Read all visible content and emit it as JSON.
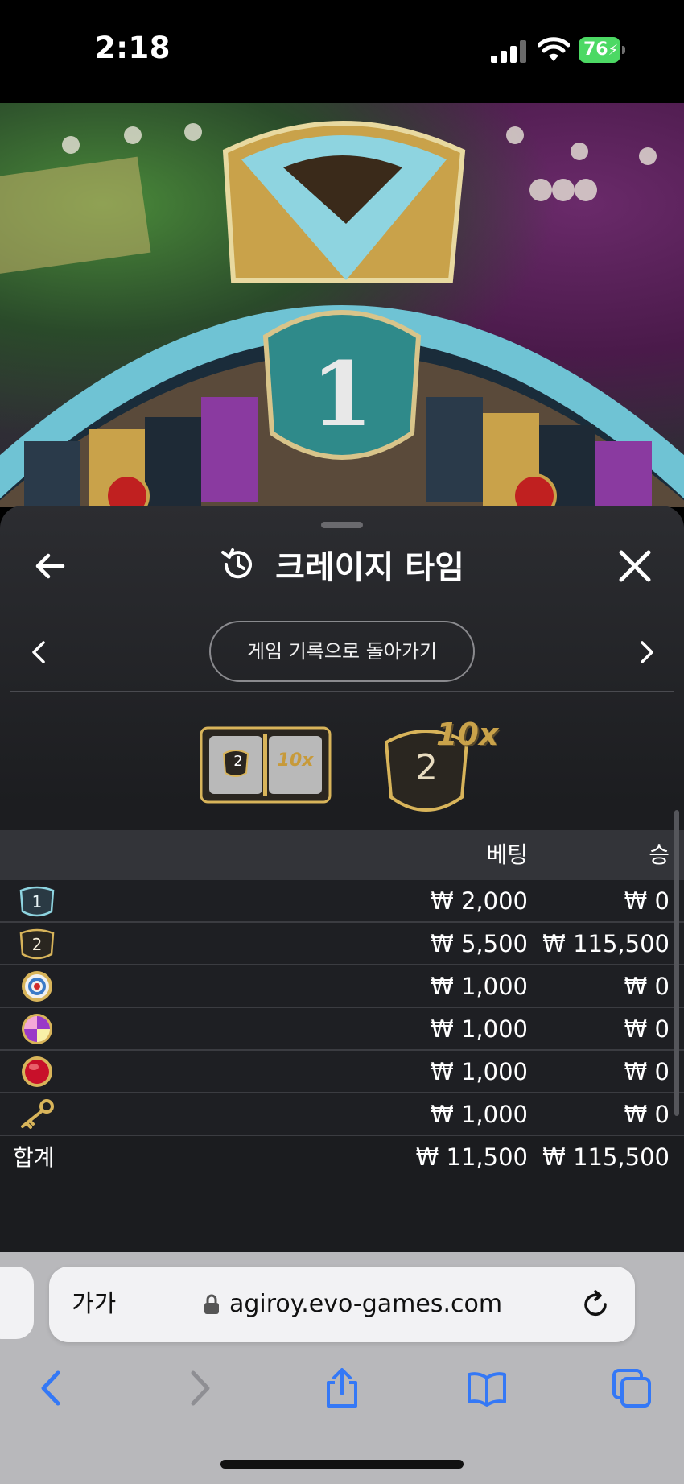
{
  "status_bar": {
    "time": "2:18",
    "battery": "76"
  },
  "sheet": {
    "title": "크레이지 타임",
    "back_label": "게임 기록으로 돌아가기",
    "result": {
      "slot_left": "2",
      "slot_right": "10x",
      "badge_number": "2",
      "badge_multiplier": "10x"
    }
  },
  "table": {
    "headers": {
      "bet": "베팅",
      "win": "승"
    },
    "rows": [
      {
        "icon": "number-1-icon",
        "bet": "₩ 2,000",
        "win": "₩ 0"
      },
      {
        "icon": "number-2-icon",
        "bet": "₩ 5,500",
        "win": "₩ 115,500"
      },
      {
        "icon": "coin-flip-target-icon",
        "bet": "₩ 1,000",
        "win": "₩ 0"
      },
      {
        "icon": "pachinko-candy-icon",
        "bet": "₩ 1,000",
        "win": "₩ 0"
      },
      {
        "icon": "cash-hunt-red-icon",
        "bet": "₩ 1,000",
        "win": "₩ 0"
      },
      {
        "icon": "crazy-time-key-icon",
        "bet": "₩ 1,000",
        "win": "₩ 0"
      }
    ],
    "total": {
      "label": "합계",
      "bet": "₩ 11,500",
      "win": "₩ 115,500"
    }
  },
  "browser": {
    "text_size_label": "가가",
    "url": "agiroy.evo-games.com"
  },
  "colors": {
    "accent_gold": "#c9a24a",
    "battery_green": "#4cd964",
    "safari_blue": "#3478f6"
  }
}
